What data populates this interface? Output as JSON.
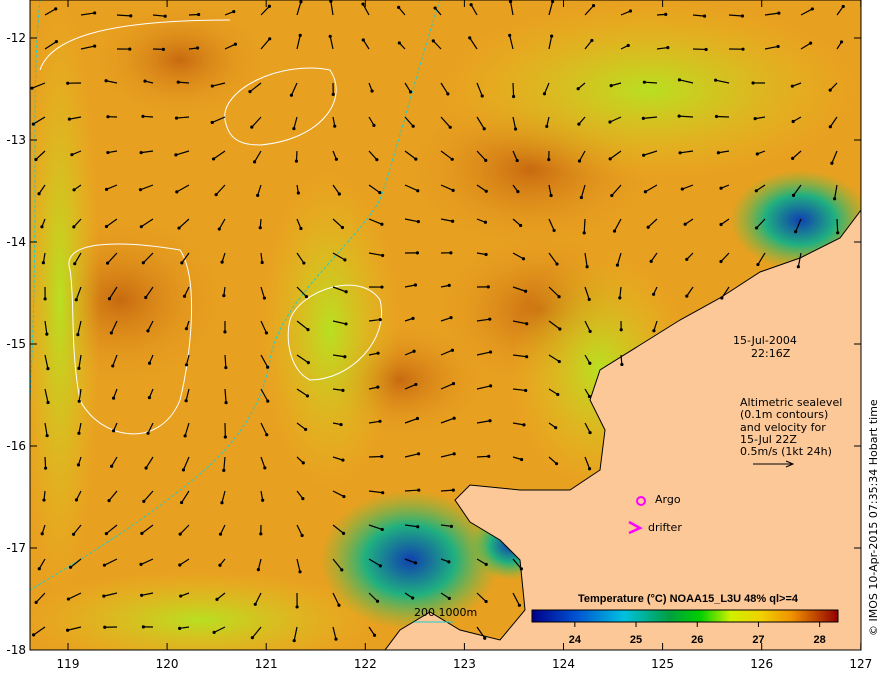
{
  "map": {
    "lon_ticks": [
      "119",
      "120",
      "121",
      "122",
      "123",
      "124",
      "125",
      "126",
      "127"
    ],
    "lat_ticks": [
      "-12",
      "-13",
      "-14",
      "-15",
      "-16",
      "-17",
      "-18"
    ],
    "date": "15-Jul-2004",
    "time": "22:16Z",
    "sealevel_note": [
      "Altimetric sealevel",
      "(0.1m contours)",
      "and velocity for",
      "15-Jul 22Z",
      "0.5m/s (1kt 24h)"
    ],
    "argo_label": "Argo",
    "drifter_label": "drifter",
    "isobath_label": "200  1000m",
    "credit": "© IMOS 10-Apr-2015 07:35:34 Hobart time",
    "colors": {
      "land": "#fdc897",
      "ocean_warm": "#e8a020",
      "isobath": "#22cccc",
      "marker": "#ff00ff"
    }
  },
  "colorbar": {
    "title": "Temperature (°C) NOAA15_L3U 48% ql>=4",
    "ticks": [
      "24",
      "25",
      "26",
      "27",
      "28"
    ],
    "range": [
      23.3,
      28.3
    ]
  }
}
